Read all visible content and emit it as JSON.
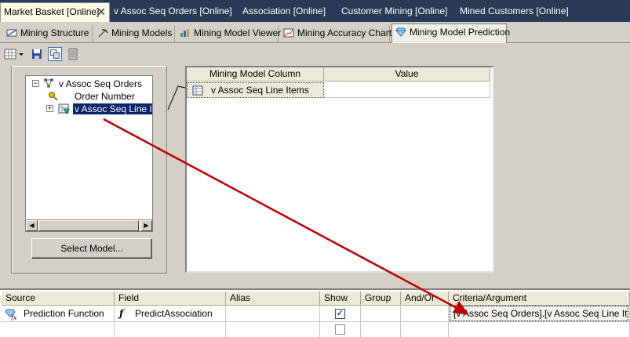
{
  "doc_tabs": [
    {
      "label": "Market Basket [Online]",
      "active": true
    },
    {
      "label": "v Assoc Seq Orders [Online]"
    },
    {
      "label": "Association [Online]"
    },
    {
      "label": "Customer Mining [Online]"
    },
    {
      "label": "Mined Customers [Online]"
    }
  ],
  "designer_tabs": [
    {
      "label": "Mining Structure"
    },
    {
      "label": "Mining Models"
    },
    {
      "label": "Mining Model Viewer"
    },
    {
      "label": "Mining Accuracy Chart"
    },
    {
      "label": "Mining Model Prediction",
      "active": true
    }
  ],
  "tree": {
    "root": "v Assoc Seq Orders",
    "child1": "Order Number",
    "child2": "v Assoc Seq Line Ite",
    "expander_root": "−",
    "expander_child": "+"
  },
  "select_model_label": "Select Model...",
  "input_grid": {
    "headers": [
      "Mining Model Column",
      "Value"
    ],
    "row": {
      "column": "v Assoc Seq Line Items",
      "value": ""
    }
  },
  "criteria_grid": {
    "headers": [
      "Source",
      "Field",
      "Alias",
      "Show",
      "Group",
      "And/Or",
      "Criteria/Argument"
    ],
    "row1": {
      "source": "Prediction Function",
      "field": "PredictAssociation",
      "alias": "",
      "show": "✓",
      "argument": "[v Assoc Seq Orders].[v Assoc Seq Line It..."
    }
  },
  "colors": {
    "tab_strip": "#2b3a57",
    "selection": "#0a246a",
    "arrow": "#c00000"
  }
}
